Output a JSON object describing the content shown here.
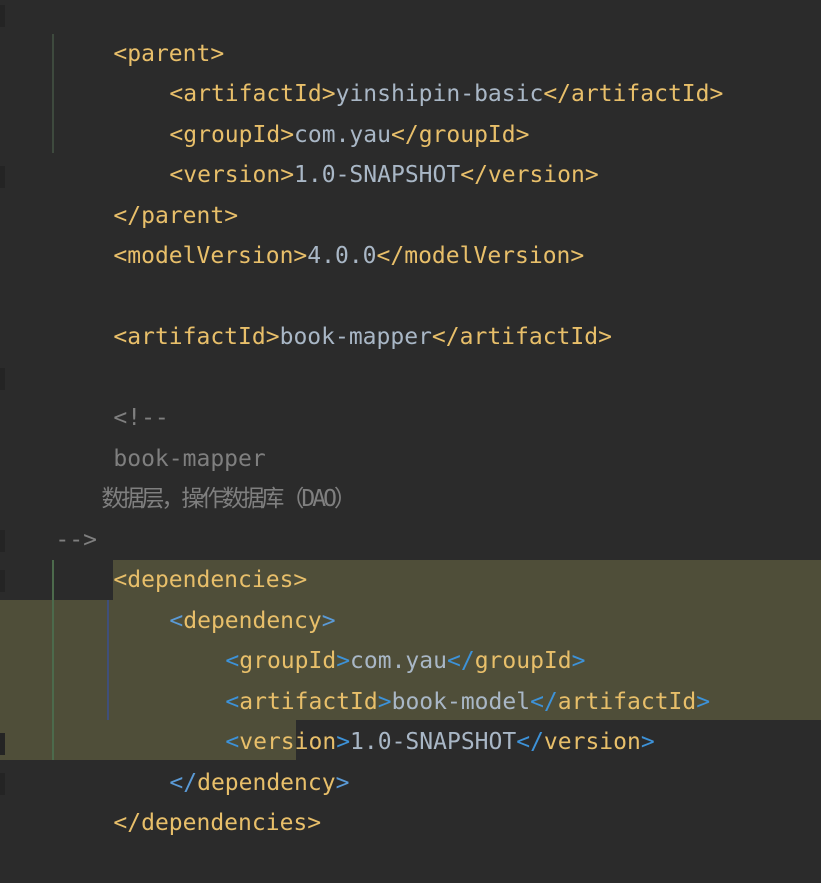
{
  "editor": {
    "lines": [
      {
        "id": "parent-open",
        "tag": "parent",
        "kind": "open"
      },
      {
        "id": "parent-artifactId",
        "tag": "artifactId",
        "value": "yinshipin-basic"
      },
      {
        "id": "parent-groupId",
        "tag": "groupId",
        "value": "com.yau"
      },
      {
        "id": "parent-version",
        "tag": "version",
        "value": "1.0-SNAPSHOT"
      },
      {
        "id": "parent-close",
        "tag": "parent",
        "kind": "close"
      },
      {
        "id": "model-version",
        "tag": "modelVersion",
        "value": "4.0.0"
      },
      {
        "id": "artifactId",
        "tag": "artifactId",
        "value": "book-mapper"
      },
      {
        "id": "comment-open",
        "text": "<!--"
      },
      {
        "id": "comment-line-1",
        "text": "book-mapper"
      },
      {
        "id": "comment-line-2",
        "text": "数据层，操作数据库（DAO）"
      },
      {
        "id": "comment-close",
        "text": "-->"
      },
      {
        "id": "dependencies-open",
        "tag": "dependencies",
        "kind": "open"
      },
      {
        "id": "dependency-open",
        "tag": "dependency",
        "kind": "open"
      },
      {
        "id": "dep-groupId",
        "tag": "groupId",
        "value": "com.yau"
      },
      {
        "id": "dep-artifactId",
        "tag": "artifactId",
        "value": "book-model"
      },
      {
        "id": "dep-version",
        "tag": "version",
        "value": "1.0-SNAPSHOT"
      },
      {
        "id": "dependency-close",
        "tag": "dependency",
        "kind": "close"
      },
      {
        "id": "dependencies-close",
        "tag": "dependencies",
        "kind": "close"
      }
    ]
  },
  "colors": {
    "background": "#2b2b2b",
    "tag": "#e8bf6a",
    "text": "#a9b7c6",
    "comment": "#7f7f7f",
    "highlight": "#4f4e39",
    "bracket_match": "#5a9ad6"
  }
}
